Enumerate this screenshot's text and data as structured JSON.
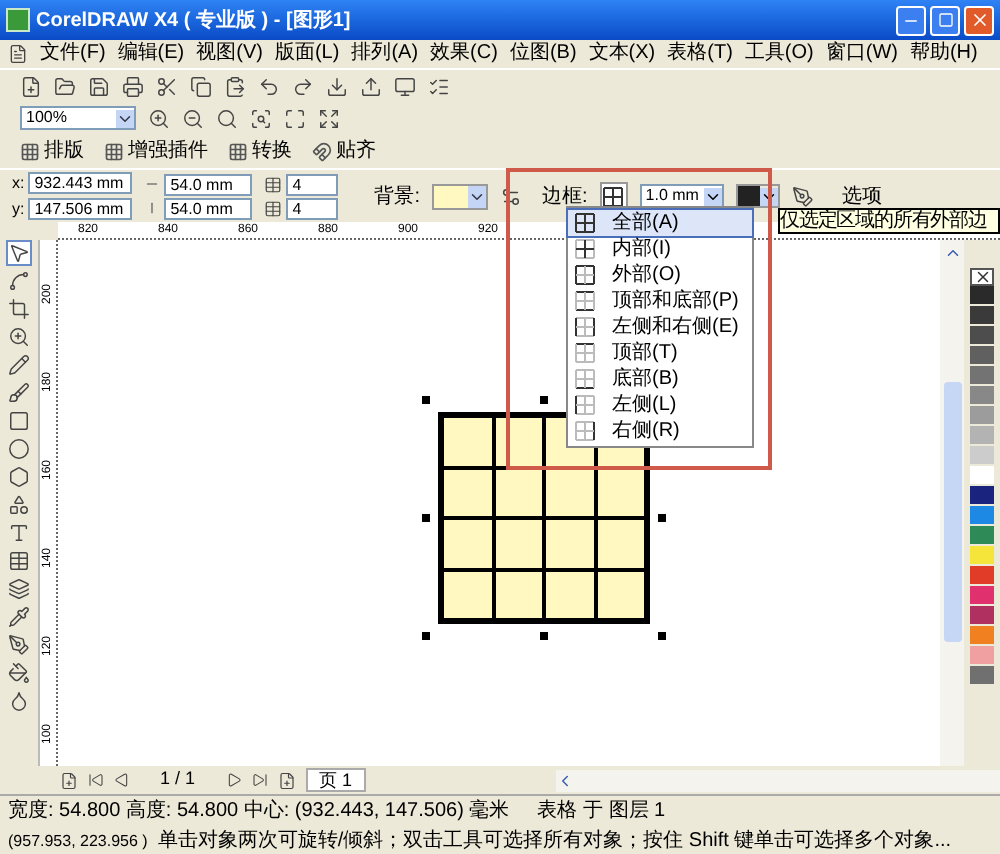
{
  "window": {
    "title": "CorelDRAW X4 ( 专业版 ) - [图形1]"
  },
  "menu": [
    "文件(F)",
    "编辑(E)",
    "视图(V)",
    "版面(L)",
    "排列(A)",
    "效果(C)",
    "位图(B)",
    "文本(X)",
    "表格(T)",
    "工具(O)",
    "窗口(W)",
    "帮助(H)"
  ],
  "zoom": {
    "value": "100%"
  },
  "plugin_toolbar": [
    "排版",
    "增强插件",
    "转换",
    "贴齐"
  ],
  "property_bar": {
    "x_label": "x:",
    "y_label": "y:",
    "x": "932.443 mm",
    "y": "147.506 mm",
    "width": "54.0 mm",
    "height": "54.0 mm",
    "rows": "4",
    "columns": "4",
    "background_label": "背景:",
    "border_label": "边框:",
    "border_width": "1.0 mm",
    "options": "选项"
  },
  "rulers": {
    "horizontal": [
      "820",
      "840",
      "860",
      "880",
      "900",
      "920"
    ],
    "vertical": [
      "200",
      "180",
      "160",
      "140",
      "120",
      "100"
    ]
  },
  "border_menu": {
    "items": [
      {
        "label": "全部(A)",
        "kind": "all",
        "selected": true
      },
      {
        "label": "内部(I)",
        "kind": "inner",
        "selected": false
      },
      {
        "label": "外部(O)",
        "kind": "outer",
        "selected": false
      },
      {
        "label": "顶部和底部(P)",
        "kind": "top-bottom",
        "selected": false
      },
      {
        "label": "左侧和右侧(E)",
        "kind": "left-right",
        "selected": false
      },
      {
        "label": "顶部(T)",
        "kind": "top",
        "selected": false
      },
      {
        "label": "底部(B)",
        "kind": "bottom",
        "selected": false
      },
      {
        "label": "左侧(L)",
        "kind": "left",
        "selected": false
      },
      {
        "label": "右侧(R)",
        "kind": "right",
        "selected": false
      }
    ]
  },
  "tooltip": "仅选定区域的所有外部边",
  "palette": [
    {
      "color": "#2a2a2a"
    },
    {
      "color": "#3a3a3a"
    },
    {
      "color": "#4d4d4d"
    },
    {
      "color": "#606060"
    },
    {
      "color": "#737373"
    },
    {
      "color": "#888888"
    },
    {
      "color": "#9c9c9c"
    },
    {
      "color": "#b3b3b3"
    },
    {
      "color": "#cccccc"
    },
    {
      "color": "#ffffff"
    },
    {
      "color": "#1a237e"
    },
    {
      "color": "#1e88e5"
    },
    {
      "color": "#2e8b57"
    },
    {
      "color": "#f5e43a"
    },
    {
      "color": "#e03c28"
    },
    {
      "color": "#e0306e"
    },
    {
      "color": "#b03060"
    },
    {
      "color": "#f08020"
    },
    {
      "color": "#f0a0a0"
    },
    {
      "color": "#707070"
    }
  ],
  "page_nav": {
    "counter": "1 / 1",
    "tab": "页 1"
  },
  "status_bar": {
    "dimensions": "宽度: 54.800 高度: 54.800 中心: (932.443, 147.506) 毫米",
    "layer": "表格 于 图层 1",
    "cursor": "(957.953, 223.956 )",
    "hint": "单击对象两次可旋转/倾斜；双击工具可选择所有对象；按住 Shift 键单击可选择多个对象..."
  }
}
